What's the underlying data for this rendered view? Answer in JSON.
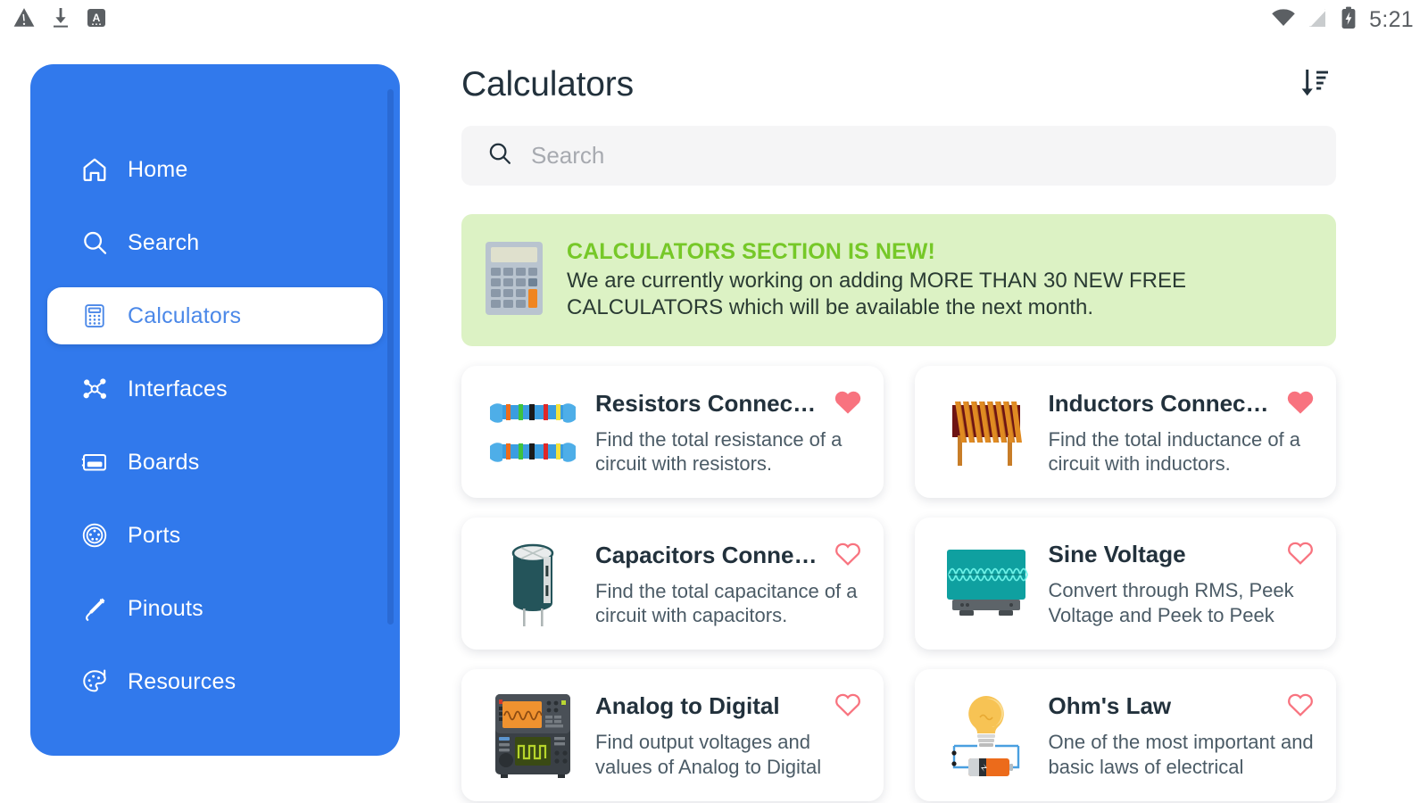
{
  "status_bar": {
    "left_icons": [
      "warning-triangle-icon",
      "download-icon",
      "app-a-icon"
    ],
    "right_icons": [
      "wifi-icon",
      "signal-off-icon",
      "battery-charging-icon"
    ],
    "clock": "5:21"
  },
  "sidebar": {
    "items": [
      {
        "label": "Home",
        "icon": "home-icon",
        "active": false
      },
      {
        "label": "Search",
        "icon": "search-icon",
        "active": false
      },
      {
        "label": "Calculators",
        "icon": "calculator-icon",
        "active": true
      },
      {
        "label": "Interfaces",
        "icon": "interfaces-icon",
        "active": false
      },
      {
        "label": "Boards",
        "icon": "board-icon",
        "active": false
      },
      {
        "label": "Ports",
        "icon": "port-icon",
        "active": false
      },
      {
        "label": "Pinouts",
        "icon": "pinout-icon",
        "active": false
      },
      {
        "label": "Resources",
        "icon": "palette-icon",
        "active": false
      }
    ],
    "accent_color": "#3179ec",
    "active_text_color": "#4b88e8"
  },
  "header": {
    "title": "Calculators",
    "sort_icon": "sort-descending-icon"
  },
  "search": {
    "icon": "search-icon",
    "value": "",
    "placeholder": "Search"
  },
  "banner": {
    "icon": "calculator-icon",
    "title": "CALCULATORS SECTION IS NEW!",
    "text": "We are currently working on adding MORE THAN 30 NEW FREE CALCULATORS which will be available the next month.",
    "background_color": "#dcf2c4",
    "title_color": "#76c828"
  },
  "cards": [
    {
      "title": "Resistors Connecting",
      "description": "Find the total resistance of a circuit with resistors.",
      "thumb": "resistors-icon",
      "favorite": true
    },
    {
      "title": "Inductors Connecti…",
      "description": "Find the total inductance of a circuit with inductors.",
      "thumb": "inductor-icon",
      "favorite": true
    },
    {
      "title": "Capacitors Connect…",
      "description": "Find the total capacitance of a circuit with capacitors.",
      "thumb": "capacitor-icon",
      "favorite": false
    },
    {
      "title": "Sine Voltage",
      "description": "Convert through RMS, Peek Voltage and Peek to Peek Voltage used in s…",
      "thumb": "oscilloscope-icon",
      "favorite": false
    },
    {
      "title": "Analog to Digital",
      "description": "Find output voltages and values of Analog to Digital Converters.",
      "thumb": "adc-instrument-icon",
      "favorite": false
    },
    {
      "title": "Ohm's Law",
      "description": "One of the most important and basic laws of electrical circuits.",
      "thumb": "lightbulb-circuit-icon",
      "favorite": false
    }
  ],
  "colors": {
    "heart_filled": "#f8737f",
    "heart_outline": "#f8737f",
    "card_background": "#ffffff",
    "page_background": "#ffffff"
  }
}
